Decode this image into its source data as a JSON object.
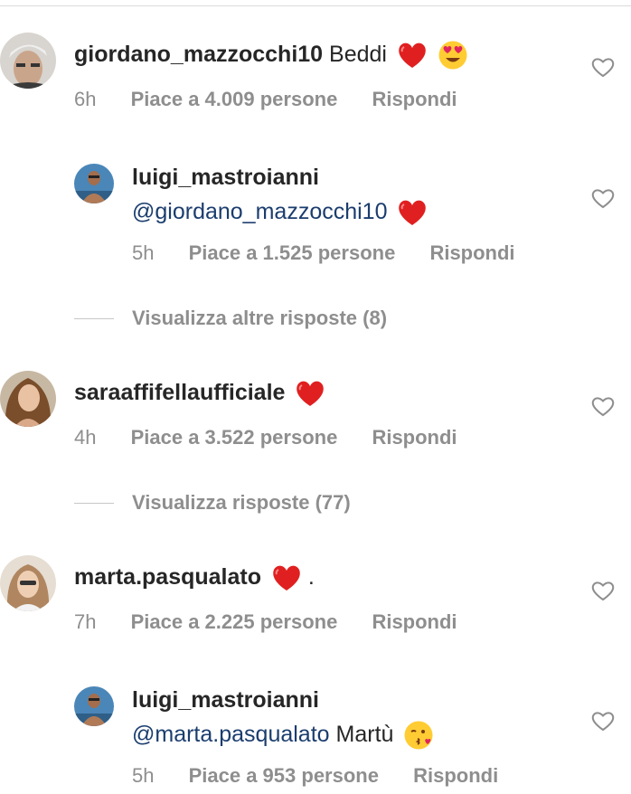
{
  "comments": [
    {
      "username": "giordano_mazzocchi10",
      "text": "Beddi",
      "mention": "",
      "emojis": [
        "red-heart",
        "heart-eyes"
      ],
      "time": "6h",
      "likes": "Piace a 4.009 persone",
      "reply": "Rispondi"
    },
    {
      "username": "luigi_mastroianni",
      "text": "",
      "mention": "@giordano_mazzocchi10",
      "emojis": [
        "red-heart"
      ],
      "time": "5h",
      "likes": "Piace a 1.525 persone",
      "reply": "Rispondi"
    },
    {
      "username": "saraaffifellaufficiale",
      "text": "",
      "mention": "",
      "emojis": [
        "red-heart"
      ],
      "time": "4h",
      "likes": "Piace a 3.522 persone",
      "reply": "Rispondi"
    },
    {
      "username": "marta.pasqualato",
      "text": ".",
      "mention": "",
      "emojis": [
        "red-heart"
      ],
      "time": "7h",
      "likes": "Piace a 2.225 persone",
      "reply": "Rispondi"
    },
    {
      "username": "luigi_mastroianni",
      "text": "Martù",
      "mention": "@marta.pasqualato",
      "emojis": [
        "kissing-heart"
      ],
      "time": "5h",
      "likes": "Piace a 953 persone",
      "reply": "Rispondi"
    }
  ],
  "view_replies": [
    {
      "label": "Visualizza altre risposte (8)"
    },
    {
      "label": "Visualizza risposte (77)"
    }
  ],
  "colors": {
    "mention": "#1b3d6e",
    "meta": "#8e8e8e",
    "heart": "#e02020"
  }
}
